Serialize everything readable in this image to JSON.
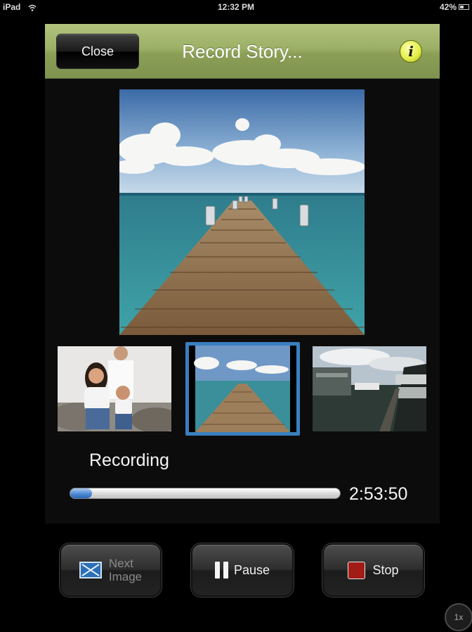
{
  "status_bar": {
    "device": "iPad",
    "time": "12:32 PM",
    "battery": "42%",
    "battery_level": 0.42
  },
  "nav": {
    "close_label": "Close",
    "title": "Record Story...",
    "info_glyph": "i"
  },
  "thumbnails": [
    {
      "subject": "family-portrait",
      "selected": false
    },
    {
      "subject": "pier-ocean",
      "selected": true
    },
    {
      "subject": "harbor-dock",
      "selected": false
    }
  ],
  "recording": {
    "status": "Recording",
    "time": "2:53:50",
    "progress": 0.08
  },
  "controls": {
    "next_line1": "Next",
    "next_line2": "Image",
    "pause": "Pause",
    "stop": "Stop"
  },
  "zoom": "1x",
  "colors": {
    "nav_green": "#9cb066",
    "selection_blue": "#3a7fbf",
    "progress_blue": "#4f8ad3",
    "stop_red": "#a21c16"
  }
}
